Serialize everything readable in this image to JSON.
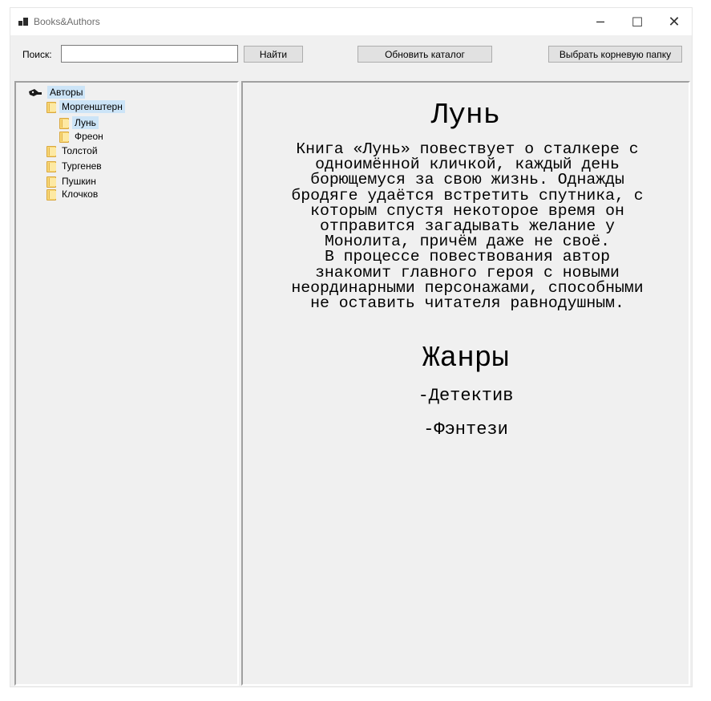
{
  "window": {
    "title": "Books&Authors",
    "controls": {
      "minimize": "─",
      "maximize": "☐",
      "close": "✕"
    }
  },
  "toolbar": {
    "search_label": "Поиск:",
    "search_value": "",
    "find_label": "Найти",
    "refresh_label": "Обновить каталог",
    "root_label": "Выбрать корневую папку"
  },
  "tree": {
    "root": {
      "label": "Авторы",
      "icon": "shield-key-icon",
      "selected": true
    },
    "authors": [
      {
        "label": "Моргенштерн",
        "icon": "folder-icon",
        "selected": true,
        "books": [
          {
            "label": "Лунь",
            "icon": "folder-icon",
            "selected": true
          },
          {
            "label": "Фреон",
            "icon": "folder-icon",
            "selected": false
          }
        ]
      },
      {
        "label": "Толстой",
        "icon": "folder-icon",
        "selected": false
      },
      {
        "label": "Тургенев",
        "icon": "folder-icon",
        "selected": false
      },
      {
        "label": "Пушкин",
        "icon": "folder-icon",
        "selected": false
      },
      {
        "label": "Клочков",
        "icon": "folder-icon",
        "selected": false
      }
    ]
  },
  "book": {
    "title": "Лунь",
    "description_lines": [
      "Книга «Лунь» повествует о сталкере с",
      "одноимённой кличкой, каждый день",
      "борющемуся за свою жизнь. Однажды",
      "бродяге удаётся встретить спутника, с",
      "которым спустя некоторое время он",
      "отправится загадывать желание у",
      "Монолита, причём даже не своё.",
      "В процессе повествования автор",
      "знакомит главного героя с новыми",
      "неординарными персонажами, способными",
      "не оставить читателя равнодушным."
    ],
    "genres_title": "Жанры",
    "genres": [
      "-Детектив",
      "-Фэнтези"
    ]
  },
  "colors": {
    "window_bg": "#f0f0f0",
    "selection": "#cce4f7",
    "button_bg": "#e1e1e1",
    "button_border": "#adadad",
    "folder": "#f8d775"
  }
}
